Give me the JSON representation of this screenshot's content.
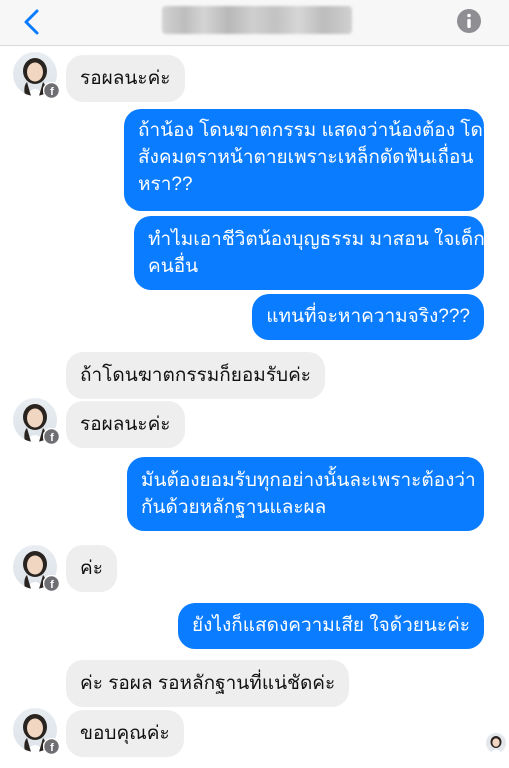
{
  "header": {
    "back_icon": "chevron-left-icon",
    "title": "",
    "info_icon": "info-icon",
    "accent_color": "#0a7cff"
  },
  "messages": [
    {
      "from": "them",
      "text": "รอผลนะค่ะ"
    },
    {
      "from": "me",
      "lines": [
        "ถ้าน้อง โดนฆาตกรรม แสดงว่าน้องต้อง โดน",
        "สังคมตราหน้าตายเพราะเหล็กดัดฟันเถื่อน",
        "หรา??"
      ]
    },
    {
      "from": "me",
      "lines": [
        "ทำไมเอาชีวิตน้องบุญธรรม มาสอน ใจเด็ก",
        "คนอื่น"
      ]
    },
    {
      "from": "me",
      "text": "แทนที่จะหาความจริง???"
    },
    {
      "from": "them",
      "text": "ถ้าโดนฆาตกรรมก็ยอมรับค่ะ"
    },
    {
      "from": "them",
      "text": "รอผลนะค่ะ"
    },
    {
      "from": "me",
      "lines": [
        "มันต้องยอมรับทุกอย่างนั้นละเพราะต้องว่า",
        "กันด้วยหลักฐานและผล"
      ]
    },
    {
      "from": "them",
      "text": "ค่ะ"
    },
    {
      "from": "me",
      "text": "ยังไงก็แสดงความเสีย ใจด้วยนะค่ะ"
    },
    {
      "from": "them",
      "text": "ค่ะ รอผล รอหลักฐานที่แน่ชัดค่ะ"
    },
    {
      "from": "them",
      "text": "ขอบคุณค่ะ"
    }
  ],
  "colors": {
    "outgoing_bubble": "#0a7cff",
    "incoming_bubble": "#eeeeef",
    "header_bg": "#f7f7f8"
  }
}
